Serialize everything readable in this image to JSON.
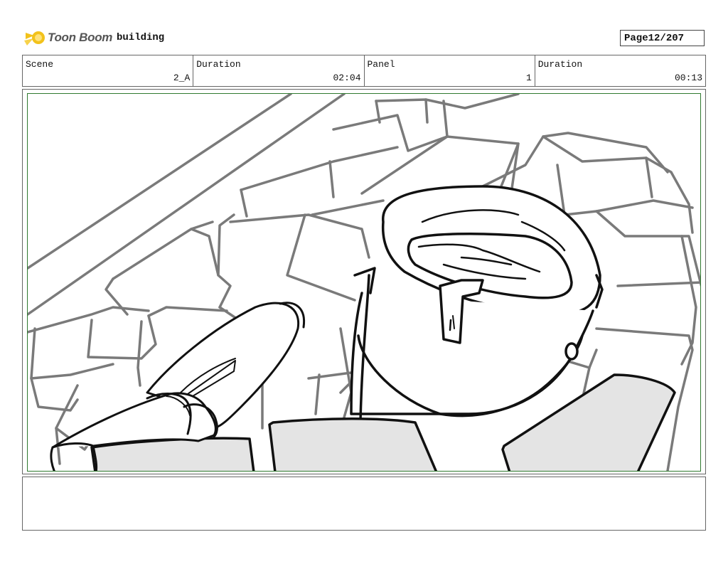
{
  "header": {
    "logo_text": "Toon Boom",
    "project_name": "building",
    "page_label": "Page",
    "page_value": "12/207"
  },
  "info": {
    "scene_label": "Scene",
    "scene_value": "2_A",
    "duration_label": "Duration",
    "duration_value": "02:04",
    "panel_label": "Panel",
    "panel_value": "1",
    "panel_duration_label": "Duration",
    "panel_duration_value": "00:13"
  },
  "colors": {
    "frame_border": "#2f7a2f",
    "sketch_gray": "#7a7a7a",
    "sketch_ink": "#111111",
    "fill_light": "#e4e4e4",
    "logo_yellow": "#f2c21b"
  },
  "notes": {
    "text": ""
  }
}
